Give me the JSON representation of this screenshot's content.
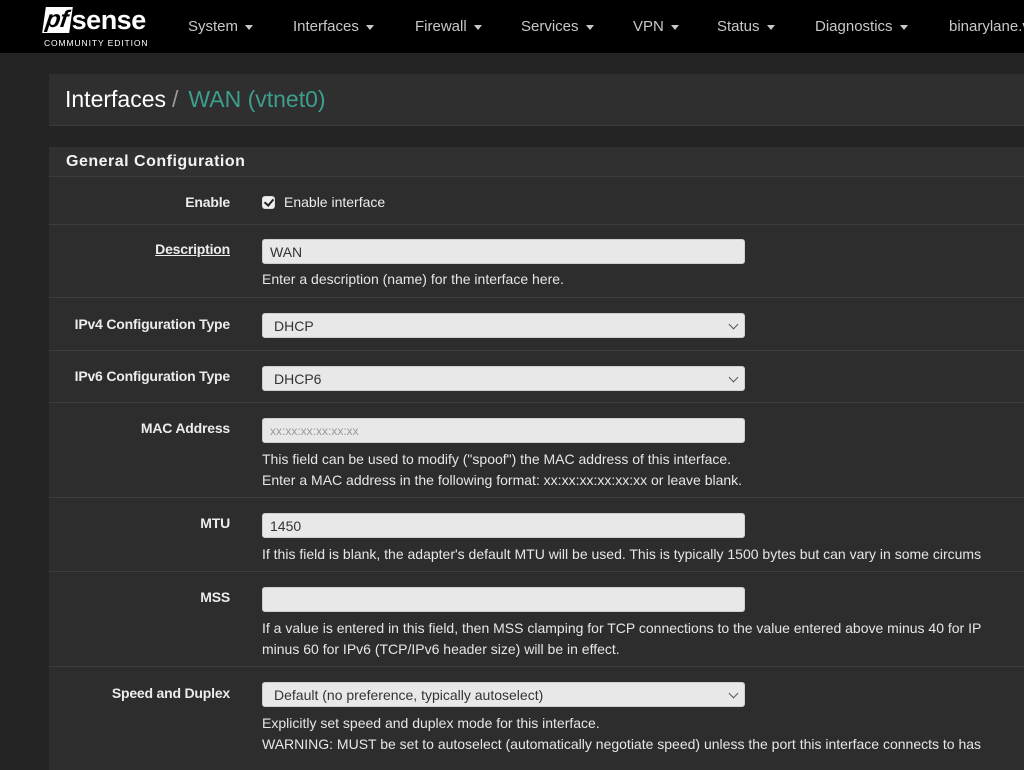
{
  "brand": {
    "logo_prefix": "pf",
    "logo_suffix": "sense",
    "edition": "COMMUNITY EDITION"
  },
  "nav": {
    "items": [
      {
        "label": "System"
      },
      {
        "label": "Interfaces"
      },
      {
        "label": "Firewall"
      },
      {
        "label": "Services"
      },
      {
        "label": "VPN"
      },
      {
        "label": "Status"
      },
      {
        "label": "Diagnostics"
      },
      {
        "label": "binarylane.v"
      }
    ]
  },
  "breadcrumb": {
    "parent": "Interfaces",
    "separator": "/",
    "current": "WAN (vtnet0)"
  },
  "panel": {
    "title": "General Configuration"
  },
  "form": {
    "enable": {
      "label": "Enable",
      "checkbox_label": "Enable interface",
      "checked": true
    },
    "description": {
      "label": "Description",
      "value": "WAN",
      "help": "Enter a description (name) for the interface here."
    },
    "ipv4_type": {
      "label": "IPv4 Configuration Type",
      "selected": "DHCP"
    },
    "ipv6_type": {
      "label": "IPv6 Configuration Type",
      "selected": "DHCP6"
    },
    "mac": {
      "label": "MAC Address",
      "placeholder": "xx:xx:xx:xx:xx:xx",
      "help_line1": "This field can be used to modify (\"spoof\") the MAC address of this interface.",
      "help_line2": "Enter a MAC address in the following format: xx:xx:xx:xx:xx:xx or leave blank."
    },
    "mtu": {
      "label": "MTU",
      "value": "1450",
      "help": "If this field is blank, the adapter's default MTU will be used. This is typically 1500 bytes but can vary in some circums"
    },
    "mss": {
      "label": "MSS",
      "value": "",
      "help_line1": "If a value is entered in this field, then MSS clamping for TCP connections to the value entered above minus 40 for IP",
      "help_line2": "minus 60 for IPv6 (TCP/IPv6 header size) will be in effect."
    },
    "speed_duplex": {
      "label": "Speed and Duplex",
      "selected": "Default (no preference, typically autoselect)",
      "help_line1": "Explicitly set speed and duplex mode for this interface.",
      "help_line2": "WARNING: MUST be set to autoselect (automatically negotiate speed) unless the port this interface connects to has"
    }
  },
  "colors": {
    "accent": "#3d9e8e",
    "navbar": "#000000",
    "background": "#242424",
    "panel": "#2d2d2d"
  }
}
